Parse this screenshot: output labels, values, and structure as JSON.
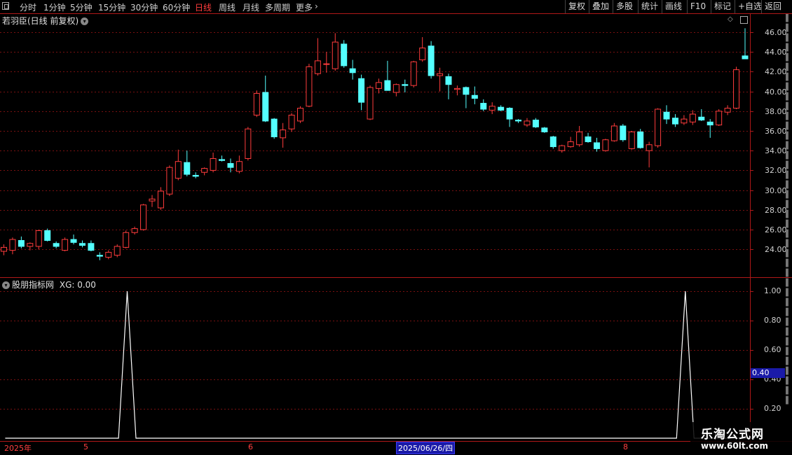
{
  "toolbar": {
    "periods": [
      "分时",
      "1分钟",
      "5分钟",
      "15分钟",
      "30分钟",
      "60分钟",
      "日线",
      "周线",
      "月线",
      "多周期",
      "更多"
    ],
    "active_period": "日线",
    "buttons": [
      "复权",
      "叠加",
      "多股",
      "统计",
      "画线",
      "F10",
      "标记",
      "+自选",
      "返回"
    ]
  },
  "main_panel": {
    "title": "若羽臣(日线 前复权)",
    "price_axis": [
      "46.00",
      "44.00",
      "42.00",
      "40.00",
      "38.00",
      "36.00",
      "34.00",
      "32.00",
      "30.00",
      "28.00",
      "26.00",
      "24.00"
    ]
  },
  "indicator_panel": {
    "title": "股朋指标网",
    "xg_label": "XG: 0.00",
    "axis": [
      "1.00",
      "0.80",
      "0.60",
      "0.40",
      "0.20"
    ],
    "cursor_value": "0.40"
  },
  "date_axis": {
    "year_label": "2025年",
    "month_5": "5",
    "month_6": "6",
    "selected_date": "2025/06/26/四",
    "month_8": "8"
  },
  "watermark": {
    "title": "乐淘公式网",
    "url": "www.60lt.com"
  },
  "colors": {
    "up": "#ff3c3c",
    "down": "#54ffff",
    "grid": "#7a1010",
    "line": "#ffffff",
    "axis": "#b01818"
  },
  "chart_data": [
    {
      "type": "candlestick",
      "title": "若羽臣(日线 前复权)",
      "ylim": [
        22.5,
        47
      ],
      "candles": [
        {
          "o": 23.8,
          "h": 24.5,
          "l": 23.4,
          "c": 24.2
        },
        {
          "o": 23.9,
          "h": 25.2,
          "l": 23.5,
          "c": 25.0
        },
        {
          "o": 24.9,
          "h": 25.3,
          "l": 24.1,
          "c": 24.3
        },
        {
          "o": 24.3,
          "h": 24.7,
          "l": 23.9,
          "c": 24.6
        },
        {
          "o": 24.3,
          "h": 26.0,
          "l": 24.0,
          "c": 25.9
        },
        {
          "o": 25.9,
          "h": 26.1,
          "l": 24.8,
          "c": 24.9
        },
        {
          "o": 24.6,
          "h": 24.8,
          "l": 24.1,
          "c": 24.3
        },
        {
          "o": 23.9,
          "h": 25.2,
          "l": 23.8,
          "c": 25.0
        },
        {
          "o": 25.0,
          "h": 25.5,
          "l": 24.5,
          "c": 24.7
        },
        {
          "o": 24.6,
          "h": 24.9,
          "l": 24.2,
          "c": 24.4
        },
        {
          "o": 24.6,
          "h": 24.9,
          "l": 23.8,
          "c": 23.9
        },
        {
          "o": 23.4,
          "h": 23.7,
          "l": 22.9,
          "c": 23.3
        },
        {
          "o": 23.2,
          "h": 23.9,
          "l": 23.0,
          "c": 23.7
        },
        {
          "o": 23.4,
          "h": 24.5,
          "l": 23.2,
          "c": 24.3
        },
        {
          "o": 24.2,
          "h": 25.9,
          "l": 24.1,
          "c": 25.7
        },
        {
          "o": 25.7,
          "h": 26.3,
          "l": 25.5,
          "c": 26.1
        },
        {
          "o": 26.0,
          "h": 28.6,
          "l": 25.9,
          "c": 28.5
        },
        {
          "o": 28.9,
          "h": 29.5,
          "l": 28.3,
          "c": 29.1
        },
        {
          "o": 28.2,
          "h": 30.3,
          "l": 28.0,
          "c": 29.9
        },
        {
          "o": 29.6,
          "h": 32.5,
          "l": 29.4,
          "c": 32.3
        },
        {
          "o": 31.2,
          "h": 34.1,
          "l": 31.0,
          "c": 32.9
        },
        {
          "o": 32.8,
          "h": 34.0,
          "l": 31.4,
          "c": 31.6
        },
        {
          "o": 31.5,
          "h": 31.8,
          "l": 31.2,
          "c": 31.4
        },
        {
          "o": 31.8,
          "h": 32.3,
          "l": 31.5,
          "c": 32.2
        },
        {
          "o": 32.0,
          "h": 33.8,
          "l": 31.8,
          "c": 33.2
        },
        {
          "o": 33.1,
          "h": 33.5,
          "l": 32.9,
          "c": 33.0
        },
        {
          "o": 32.7,
          "h": 33.2,
          "l": 31.8,
          "c": 32.3
        },
        {
          "o": 31.9,
          "h": 33.5,
          "l": 31.7,
          "c": 32.9
        },
        {
          "o": 33.2,
          "h": 36.4,
          "l": 33.0,
          "c": 36.2
        },
        {
          "o": 37.6,
          "h": 40.1,
          "l": 37.4,
          "c": 39.8
        },
        {
          "o": 39.9,
          "h": 41.6,
          "l": 36.9,
          "c": 37.0
        },
        {
          "o": 37.2,
          "h": 37.3,
          "l": 35.2,
          "c": 35.4
        },
        {
          "o": 35.3,
          "h": 36.8,
          "l": 34.3,
          "c": 36.1
        },
        {
          "o": 36.2,
          "h": 37.8,
          "l": 35.9,
          "c": 37.6
        },
        {
          "o": 37.0,
          "h": 38.5,
          "l": 36.8,
          "c": 38.3
        },
        {
          "o": 38.5,
          "h": 42.8,
          "l": 38.4,
          "c": 42.5
        },
        {
          "o": 41.8,
          "h": 45.4,
          "l": 41.6,
          "c": 43.1
        },
        {
          "o": 42.8,
          "h": 44.0,
          "l": 41.9,
          "c": 42.8
        },
        {
          "o": 42.3,
          "h": 45.9,
          "l": 42.1,
          "c": 45.0
        },
        {
          "o": 44.8,
          "h": 45.2,
          "l": 42.4,
          "c": 42.6
        },
        {
          "o": 42.3,
          "h": 43.2,
          "l": 41.2,
          "c": 41.9
        },
        {
          "o": 41.3,
          "h": 41.7,
          "l": 38.1,
          "c": 38.9
        },
        {
          "o": 37.2,
          "h": 40.6,
          "l": 37.1,
          "c": 40.4
        },
        {
          "o": 40.3,
          "h": 41.3,
          "l": 39.8,
          "c": 40.9
        },
        {
          "o": 41.1,
          "h": 43.1,
          "l": 40.4,
          "c": 40.1
        },
        {
          "o": 39.9,
          "h": 40.8,
          "l": 39.5,
          "c": 40.7
        },
        {
          "o": 40.7,
          "h": 41.2,
          "l": 39.9,
          "c": 40.6
        },
        {
          "o": 40.6,
          "h": 43.1,
          "l": 40.4,
          "c": 43.0
        },
        {
          "o": 43.2,
          "h": 45.5,
          "l": 43.0,
          "c": 44.4
        },
        {
          "o": 44.6,
          "h": 45.1,
          "l": 41.3,
          "c": 41.6
        },
        {
          "o": 41.6,
          "h": 42.4,
          "l": 40.0,
          "c": 41.8
        },
        {
          "o": 41.5,
          "h": 41.8,
          "l": 39.2,
          "c": 40.7
        },
        {
          "o": 40.2,
          "h": 40.6,
          "l": 39.6,
          "c": 40.3
        },
        {
          "o": 40.4,
          "h": 40.5,
          "l": 38.3,
          "c": 39.7
        },
        {
          "o": 39.6,
          "h": 40.5,
          "l": 38.7,
          "c": 39.3
        },
        {
          "o": 38.8,
          "h": 39.2,
          "l": 38.0,
          "c": 38.2
        },
        {
          "o": 38.1,
          "h": 38.9,
          "l": 37.7,
          "c": 38.5
        },
        {
          "o": 38.4,
          "h": 38.6,
          "l": 38.0,
          "c": 38.1
        },
        {
          "o": 38.3,
          "h": 38.4,
          "l": 36.4,
          "c": 37.2
        },
        {
          "o": 37.1,
          "h": 37.2,
          "l": 36.8,
          "c": 37.0
        },
        {
          "o": 36.6,
          "h": 37.3,
          "l": 36.4,
          "c": 37.0
        },
        {
          "o": 37.1,
          "h": 37.3,
          "l": 36.3,
          "c": 36.4
        },
        {
          "o": 36.3,
          "h": 36.4,
          "l": 35.8,
          "c": 35.9
        },
        {
          "o": 35.4,
          "h": 35.5,
          "l": 34.2,
          "c": 34.4
        },
        {
          "o": 34.0,
          "h": 34.6,
          "l": 33.8,
          "c": 34.5
        },
        {
          "o": 34.4,
          "h": 35.4,
          "l": 34.3,
          "c": 34.9
        },
        {
          "o": 34.6,
          "h": 36.5,
          "l": 34.4,
          "c": 35.9
        },
        {
          "o": 35.4,
          "h": 35.8,
          "l": 34.8,
          "c": 34.9
        },
        {
          "o": 34.8,
          "h": 35.3,
          "l": 33.9,
          "c": 34.2
        },
        {
          "o": 34.0,
          "h": 35.2,
          "l": 33.9,
          "c": 35.1
        },
        {
          "o": 35.0,
          "h": 36.8,
          "l": 34.9,
          "c": 36.5
        },
        {
          "o": 36.5,
          "h": 36.7,
          "l": 34.9,
          "c": 35.1
        },
        {
          "o": 34.2,
          "h": 36.0,
          "l": 34.1,
          "c": 35.9
        },
        {
          "o": 35.9,
          "h": 36.2,
          "l": 34.2,
          "c": 34.3
        },
        {
          "o": 34.0,
          "h": 34.9,
          "l": 32.3,
          "c": 34.6
        },
        {
          "o": 34.5,
          "h": 38.3,
          "l": 34.3,
          "c": 38.2
        },
        {
          "o": 37.9,
          "h": 38.6,
          "l": 36.7,
          "c": 37.2
        },
        {
          "o": 37.3,
          "h": 37.7,
          "l": 36.4,
          "c": 36.7
        },
        {
          "o": 36.8,
          "h": 37.6,
          "l": 36.6,
          "c": 37.2
        },
        {
          "o": 36.9,
          "h": 38.1,
          "l": 36.6,
          "c": 37.7
        },
        {
          "o": 37.4,
          "h": 38.2,
          "l": 37.0,
          "c": 37.1
        },
        {
          "o": 36.9,
          "h": 37.2,
          "l": 35.3,
          "c": 36.6
        },
        {
          "o": 36.6,
          "h": 38.2,
          "l": 36.5,
          "c": 38.0
        },
        {
          "o": 37.9,
          "h": 38.6,
          "l": 37.6,
          "c": 38.3
        },
        {
          "o": 38.3,
          "h": 42.5,
          "l": 38.2,
          "c": 42.2
        },
        {
          "o": 43.6,
          "h": 46.4,
          "l": 43.4,
          "c": 43.3
        }
      ]
    },
    {
      "type": "line",
      "title": "股朋指标网",
      "ylim": [
        0,
        1.05
      ],
      "series": [
        {
          "name": "XG",
          "values_nonzero": {
            "14": 1.0,
            "78": 1.0
          }
        }
      ],
      "count": 87
    }
  ]
}
